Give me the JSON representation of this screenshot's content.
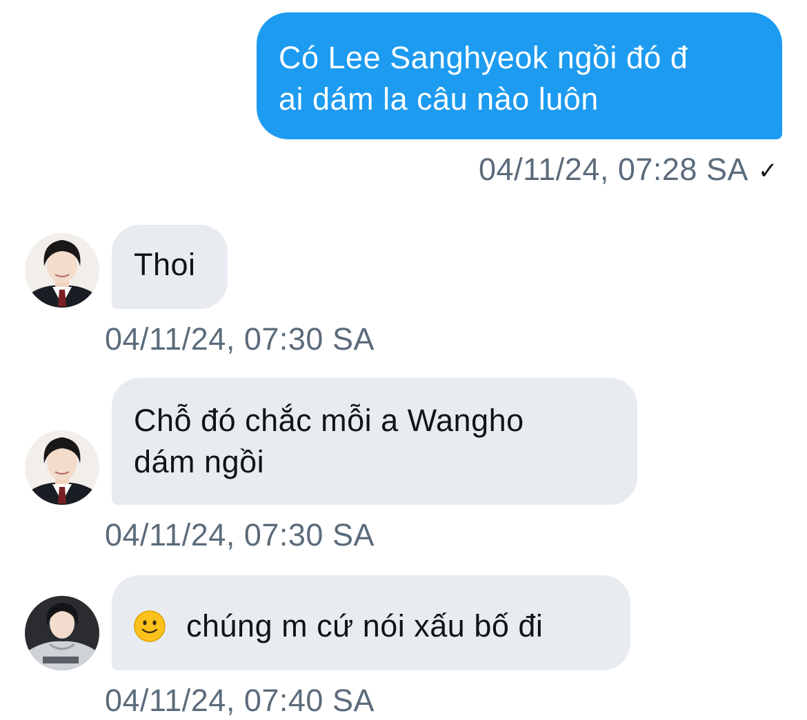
{
  "messages": [
    {
      "direction": "sent",
      "lines": [
        "Có Lee Sanghyeok ngồi đó đ",
        "ai dám la câu nào luôn"
      ],
      "timestamp": "04/11/24, 07:28 SA",
      "status_icon": "checkmark-icon"
    },
    {
      "direction": "received",
      "avatar": "avatar-school-uniform",
      "lines": [
        "Thoi"
      ],
      "timestamp": "04/11/24, 07:30 SA"
    },
    {
      "direction": "received",
      "avatar": "avatar-school-uniform",
      "lines": [
        "Chỗ đó chắc mỗi a Wangho",
        "dám ngồi"
      ],
      "timestamp": "04/11/24, 07:30 SA"
    },
    {
      "direction": "received",
      "avatar": "avatar-hoodie",
      "emoji": "slightly-smiling-face-icon",
      "lines": [
        "chúng m cứ nói xấu bố đi"
      ],
      "timestamp": "04/11/24, 07:40 SA"
    }
  ],
  "colors": {
    "sent_bubble": "#1d9bf0",
    "received_bubble": "#e8ecf0",
    "timestamp_text": "#5b6b7b",
    "message_text": "#0f1419"
  }
}
